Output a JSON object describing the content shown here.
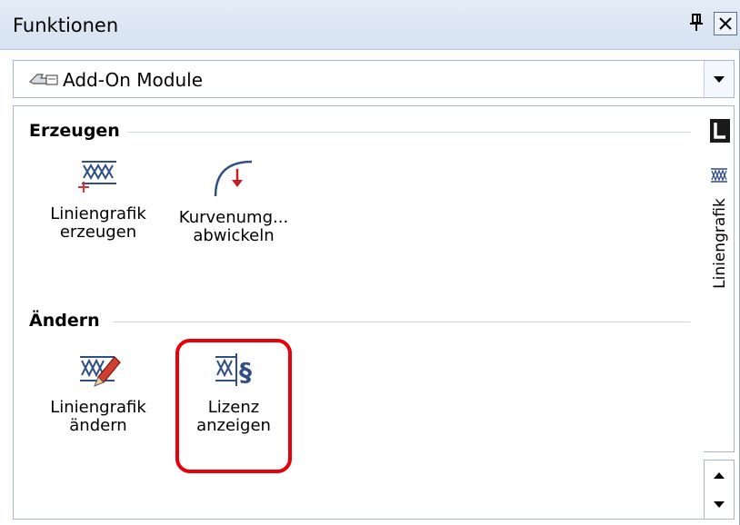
{
  "panel": {
    "title": "Funktionen",
    "pin_icon": "pin-icon",
    "close_icon": "close-icon"
  },
  "dropdown": {
    "value": "Add-On Module",
    "icon": "add-on-modules-icon",
    "arrow_icon": "chevron-down-icon"
  },
  "sections": [
    {
      "header": "Erzeugen",
      "tools": [
        {
          "label_line1": "Liniengrafik",
          "label_line2": "erzeugen",
          "icon": "create-line-graphic-icon"
        },
        {
          "label_line1": "Kurvenumg...",
          "label_line2": "abwickeln",
          "icon": "unroll-curve-icon"
        }
      ]
    },
    {
      "header": "Ändern",
      "tools": [
        {
          "label_line1": "Liniengrafik",
          "label_line2": "ändern",
          "icon": "edit-line-graphic-icon"
        },
        {
          "label_line1": "Lizenz",
          "label_line2": "anzeigen",
          "icon": "show-license-icon"
        }
      ]
    }
  ],
  "side_tabs": {
    "active_icon": "l-tab-icon",
    "tool_icon": "line-graphic-icon",
    "label": "Liniengrafik"
  },
  "colors": {
    "highlight": "#e8000b",
    "icon_blue": "#2f4f86",
    "titlebar": "#dae5f3"
  }
}
